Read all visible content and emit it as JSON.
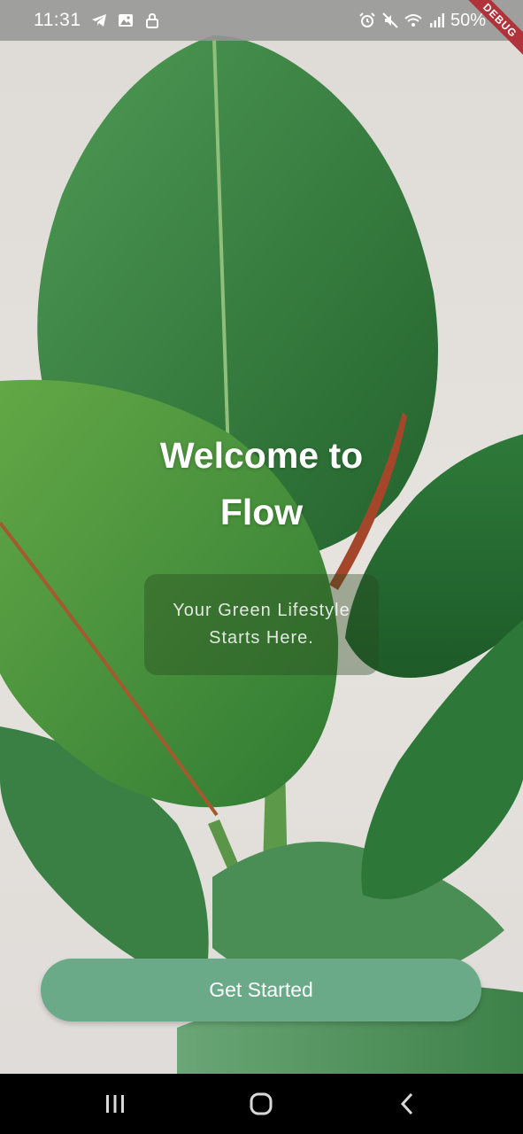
{
  "status_bar": {
    "time": "11:31",
    "battery": "50%",
    "left_icons": [
      "telegram-icon",
      "gallery-icon",
      "lock-icon"
    ],
    "right_icons": [
      "alarm-icon",
      "mute-icon",
      "wifi-icon",
      "signal-icon"
    ]
  },
  "debug_banner": "DEBUG",
  "welcome": {
    "title_line1": "Welcome to",
    "title_line2": "Flow"
  },
  "tagline": "Your Green Lifestyle Starts Here.",
  "cta": {
    "label": "Get Started",
    "color": "#6aaa88"
  },
  "nav_bar": {
    "buttons": [
      "recent-apps-icon",
      "home-icon",
      "back-icon"
    ]
  }
}
